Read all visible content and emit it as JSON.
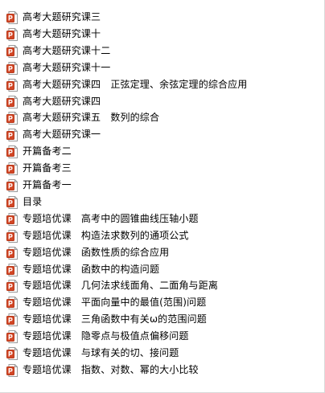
{
  "file_list": {
    "icon": "powerpoint-file-icon",
    "colors": {
      "icon_fill": "#d24625",
      "icon_border": "#b73a1c",
      "icon_paper": "#ffffff",
      "text": "#000000"
    },
    "items": [
      {
        "label": "高考大题研究课三"
      },
      {
        "label": "高考大题研究课十"
      },
      {
        "label": "高考大题研究课十二"
      },
      {
        "label": "高考大题研究课十一"
      },
      {
        "label": "高考大题研究课四　正弦定理、余弦定理的综合应用"
      },
      {
        "label": "高考大题研究课四"
      },
      {
        "label": "高考大题研究课五　数列的综合"
      },
      {
        "label": "高考大题研究课一"
      },
      {
        "label": "开篇备考二"
      },
      {
        "label": "开篇备考三"
      },
      {
        "label": "开篇备考一"
      },
      {
        "label": "目录"
      },
      {
        "label": "专题培优课　高考中的圆锥曲线压轴小题"
      },
      {
        "label": "专题培优课　构造法求数列的通项公式"
      },
      {
        "label": "专题培优课　函数性质的综合应用"
      },
      {
        "label": "专题培优课　函数中的构造问题"
      },
      {
        "label": "专题培优课　几何法求线面角、二面角与距离"
      },
      {
        "label": "专题培优课　平面向量中的最值(范围)问题"
      },
      {
        "label": "专题培优课　三角函数中有关ω的范围问题"
      },
      {
        "label": "专题培优课　隐零点与极值点偏移问题"
      },
      {
        "label": "专题培优课　与球有关的切、接问题"
      },
      {
        "label": "专题培优课　指数、对数、幂的大小比较"
      }
    ]
  }
}
